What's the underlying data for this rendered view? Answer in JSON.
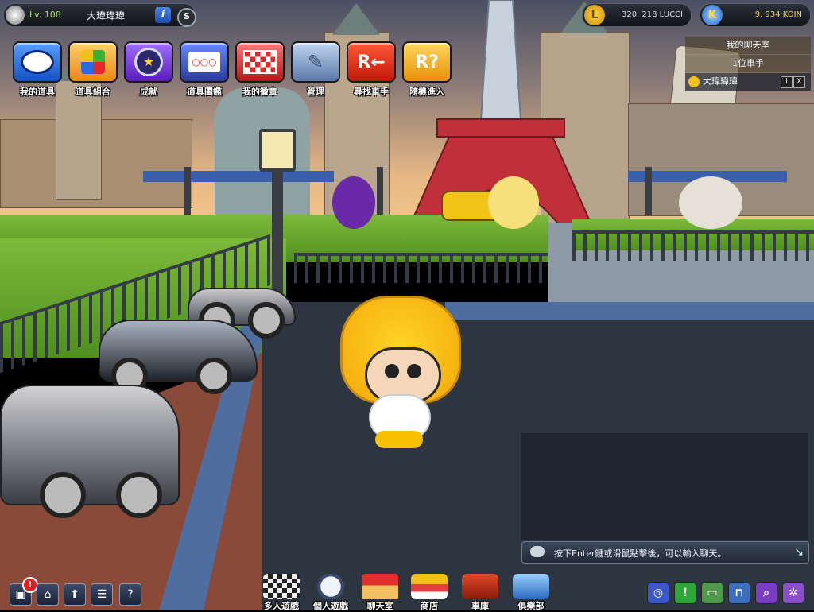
{
  "profile": {
    "level": "Lv. 108",
    "name": "大瑋瑋瑋",
    "info_icon": "info-icon",
    "s_icon": "s-icon"
  },
  "currency": {
    "lucci_icon": "L",
    "lucci": "320, 218 LUCCI",
    "koin_icon": "K",
    "koin": "9, 934 KOIN"
  },
  "menu": {
    "items": [
      {
        "label": "我的道具",
        "icon": "my-items-icon",
        "color": "#1d6fe0"
      },
      {
        "label": "道具組合",
        "icon": "puzzle-icon",
        "color": "#e8a020"
      },
      {
        "label": "成就",
        "icon": "achievement-icon",
        "color": "#7b34d8"
      },
      {
        "label": "道具圖鑑",
        "icon": "catalog-icon",
        "color": "#4b5ab0"
      },
      {
        "label": "我的徽章",
        "icon": "badge-icon",
        "color": "#d83838"
      },
      {
        "label": "管理",
        "icon": "manage-icon",
        "color": "#6c8fc0"
      },
      {
        "label": "尋找車手",
        "icon": "find-racer-icon",
        "color": "#e02818"
      },
      {
        "label": "隨機進入",
        "icon": "random-enter-icon",
        "color": "#f2a20a"
      }
    ]
  },
  "chatroom": {
    "title": "我的聊天室",
    "count": "1位車手",
    "member": "大瑋瑋瑋",
    "info_btn": "i",
    "close_btn": "X"
  },
  "chat": {
    "placeholder": "按下Enter鍵或滑鼠點擊後，可以輸入聊天。"
  },
  "bottom_nav": {
    "items": [
      {
        "label": "多人遊戲",
        "icon": "multiplayer-icon"
      },
      {
        "label": "個人遊戲",
        "icon": "single-player-icon"
      },
      {
        "label": "聊天室",
        "icon": "chatroom-icon"
      },
      {
        "label": "商店",
        "icon": "shop-icon"
      },
      {
        "label": "車庫",
        "icon": "garage-icon"
      },
      {
        "label": "俱樂部",
        "icon": "club-icon"
      }
    ]
  },
  "bottom_left": {
    "alert": "!"
  },
  "bottom_right": {
    "buttons": [
      {
        "icon": "alarm-icon",
        "color": "#3c58c8",
        "glyph": "◎"
      },
      {
        "icon": "notice-icon",
        "color": "#2fa83a",
        "glyph": "!"
      },
      {
        "icon": "message-icon",
        "color": "#4f9a4a",
        "glyph": "▭"
      },
      {
        "icon": "mailbox-icon",
        "color": "#3c6fc0",
        "glyph": "⊓"
      },
      {
        "icon": "search-icon",
        "color": "#7a3cc0",
        "glyph": "⌕"
      },
      {
        "icon": "settings-icon",
        "color": "#8a4ec8",
        "glyph": "✲"
      }
    ]
  }
}
